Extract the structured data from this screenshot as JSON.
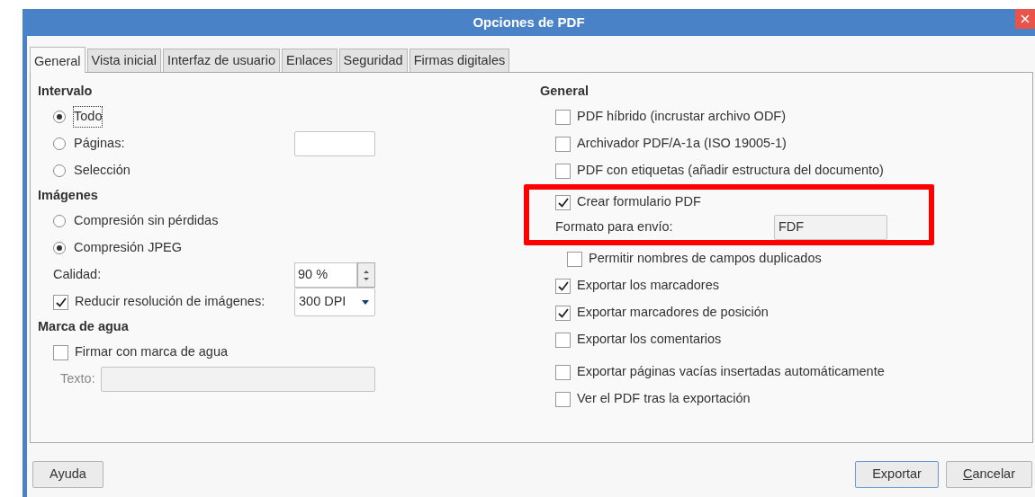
{
  "window": {
    "title": "Opciones de PDF"
  },
  "tabs": [
    {
      "label": "General",
      "selected": true
    },
    {
      "label": "Vista inicial",
      "selected": false
    },
    {
      "label": "Interfaz de usuario",
      "selected": false
    },
    {
      "label": "Enlaces",
      "selected": false
    },
    {
      "label": "Seguridad",
      "selected": false
    },
    {
      "label": "Firmas digitales",
      "selected": false
    }
  ],
  "left_sections": [
    {
      "heading": "Intervalo",
      "rows": [
        {
          "kind": "radio",
          "label": "Todo",
          "selected": true,
          "focused": true
        },
        {
          "kind": "radio_field",
          "label": "Páginas:",
          "selected": false,
          "focused": false
        },
        {
          "kind": "radio",
          "label": "Selección",
          "selected": false,
          "focused": false
        }
      ]
    },
    {
      "heading": "Imágenes",
      "rows": [
        {
          "kind": "radio",
          "label": "Compresión sin pérdidas",
          "selected": false,
          "focused": false
        },
        {
          "kind": "radio",
          "label": "Compresión JPEG",
          "selected": true,
          "focused": false
        },
        {
          "kind": "spin",
          "label": "Calidad:",
          "value": "90 %"
        },
        {
          "kind": "checkbox_select",
          "label": "Reducir resolución de imágenes:",
          "checked": true,
          "value": "300 DPI"
        }
      ]
    },
    {
      "heading": "Marca de agua",
      "rows": [
        {
          "kind": "checkbox",
          "label": "Firmar con marca de agua",
          "checked": false
        },
        {
          "kind": "text_field",
          "label": "Texto:",
          "disabled": true
        }
      ]
    }
  ],
  "right_section": {
    "heading": "General",
    "rows": [
      {
        "kind": "checkbox",
        "label": "PDF híbrido (incrustar archivo ODF)",
        "checked": false,
        "highlighted": false
      },
      {
        "kind": "checkbox",
        "label": "Archivador PDF/A-1a (ISO 19005-1)",
        "checked": false,
        "highlighted": false
      },
      {
        "kind": "checkbox",
        "label": "PDF con etiquetas (añadir estructura del documento)",
        "checked": false,
        "highlighted": false
      },
      {
        "kind": "checkbox",
        "label": "Crear formulario PDF",
        "checked": true,
        "highlighted": true
      },
      {
        "kind": "field",
        "label": "Formato para envío:",
        "value": "FDF",
        "highlighted": true
      },
      {
        "kind": "sub_checkbox",
        "label": "Permitir nombres de campos duplicados",
        "checked": false,
        "highlighted": false
      },
      {
        "kind": "checkbox",
        "label": "Exportar los marcadores",
        "checked": true,
        "highlighted": false
      },
      {
        "kind": "checkbox",
        "label": "Exportar marcadores de posición",
        "checked": true,
        "highlighted": false
      },
      {
        "kind": "checkbox",
        "label": "Exportar los comentarios",
        "checked": false,
        "highlighted": false
      },
      {
        "kind": "spacer"
      },
      {
        "kind": "checkbox",
        "label": "Exportar páginas vacías insertadas automáticamente",
        "checked": false,
        "highlighted": false
      },
      {
        "kind": "checkbox",
        "label": "Ver el PDF tras la exportación",
        "checked": false,
        "highlighted": false
      }
    ]
  },
  "buttons_left": [
    {
      "label": "Ayuda",
      "default": false,
      "mnemonic": false
    }
  ],
  "buttons_right": [
    {
      "label": "Exportar",
      "default": true,
      "mnemonic": false
    },
    {
      "label": "Cancelar",
      "default": false,
      "mnemonic": true
    }
  ]
}
